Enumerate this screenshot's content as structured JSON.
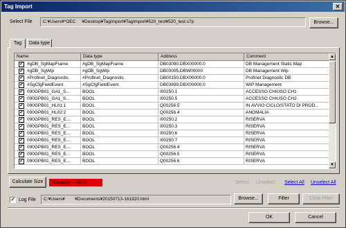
{
  "window": {
    "title": "Tag Import"
  },
  "select_file": {
    "label": "Select File",
    "value": "C:¥Users¥*OEC     ¥Desktop¥TagImport¥TagImport¥520_test¥520_test.s7p",
    "browse_label": "Browse..."
  },
  "tabs": [
    {
      "label": "Tag"
    },
    {
      "label": "Data type"
    }
  ],
  "grid": {
    "columns": [
      "Name",
      "Data type",
      "Address",
      "Comment"
    ],
    "rows": [
      {
        "name": "#gDB_SgMapFrame",
        "dtype": "#gDB_SgMapFrame",
        "address": "DB03090.DBX00000.0",
        "comment": "DB Management Static Map"
      },
      {
        "name": "#gDB_SgWip",
        "dtype": "#gDB_SgWip",
        "address": "DB03005.DBW00000",
        "comment": "DB Management Wip"
      },
      {
        "name": "#Profinet_Diagnostic",
        "dtype": "#Profinet_Diagnostic",
        "address": "DB00150.DBX00000.0",
        "comment": "Profinet Diagnostic DB"
      },
      {
        "name": "#SgCfgFieldEvent",
        "dtype": "#SgCfgFieldEvent",
        "address": "DB03999.DBX00000.0",
        "comment": "WIP Management"
      },
      {
        "name": "090GPB01_GA1_S...",
        "dtype": "BOOL",
        "address": "I00250.1",
        "comment": "ACCESSO CHIUSO CH1"
      },
      {
        "name": "090GPB01_GA1_S...",
        "dtype": "BOOL",
        "address": "I00250.5",
        "comment": "ACCESSO CHIUSO CH2"
      },
      {
        "name": "090GPB01_HL01:1",
        "dtype": "BOOL",
        "address": "Q00256.5",
        "comment": "IN AVVIO CICLO/STATO DI PROD..."
      },
      {
        "name": "090GPB01_HL02:2",
        "dtype": "BOOL",
        "address": "Q00256.4",
        "comment": "ANOMALIA"
      },
      {
        "name": "090GPB01_RES_E...",
        "dtype": "BOOL",
        "address": "I00250.2",
        "comment": "RISERVA"
      },
      {
        "name": "090GPB01_RES_E...",
        "dtype": "BOOL",
        "address": "I00250.3",
        "comment": "RISERVA"
      },
      {
        "name": "090GPB01_RES_E...",
        "dtype": "BOOL",
        "address": "I00250.6",
        "comment": "RISERVA"
      },
      {
        "name": "090GPB01_RES_E...",
        "dtype": "BOOL",
        "address": "I00250.7",
        "comment": "RISERVA"
      },
      {
        "name": "090GPB01_RES_E...",
        "dtype": "BOOL",
        "address": "Q00256.4",
        "comment": "RISERVA"
      },
      {
        "name": "090GPB01_RES_E...",
        "dtype": "BOOL",
        "address": "Q00256.5",
        "comment": "RISERVA"
      },
      {
        "name": "090GPB01_RES_E...",
        "dtype": "BOOL",
        "address": "Q00256.6",
        "comment": "RISERVA"
      }
    ]
  },
  "bottom": {
    "calc_label": "Calculate Size",
    "capacity_text": "Capacity : 946 %",
    "select_label": "Select",
    "unselect_label": "Unselect",
    "select_all_label": "Select All",
    "unselect_all_label": "Unselect All",
    "log_label": "Log File",
    "log_value": "C:¥Users¥        ¥Documents¥20150713-161920.html",
    "log_browse_label": "Browse...",
    "filter_label": "Filter",
    "clear_filter_label": "Clear Filter",
    "ok_label": "OK",
    "cancel_label": "Cancel"
  },
  "colors": {
    "title_bar": "#0a246a",
    "capacity_bg": "#e00000",
    "link": "#0000c0"
  },
  "icons": {
    "close": "close-icon",
    "check": "checkmark",
    "scroll_up": "up-arrow",
    "scroll_down": "down-arrow"
  }
}
